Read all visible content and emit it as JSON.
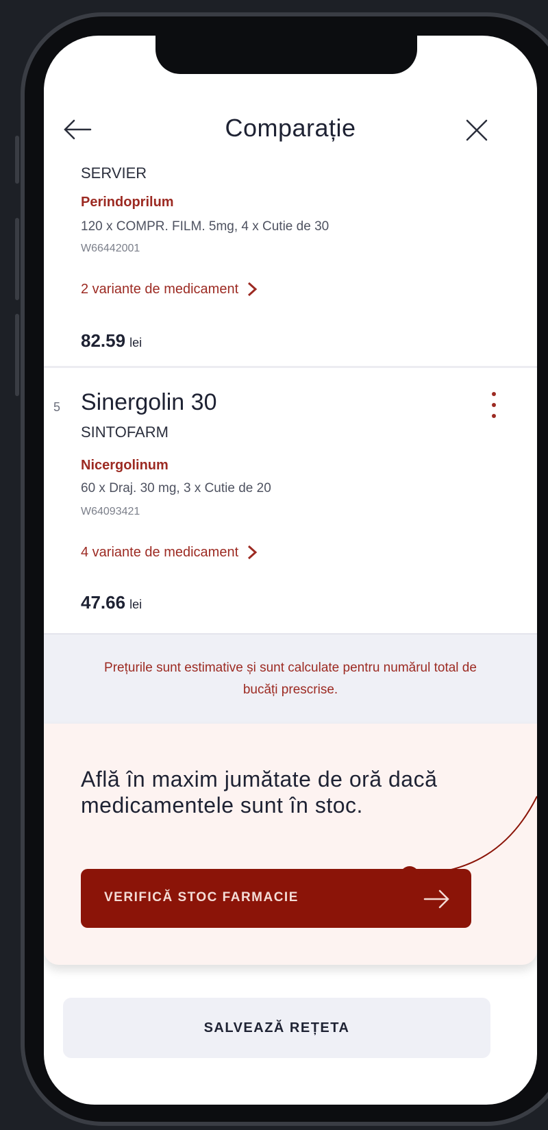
{
  "header": {
    "title": "Comparație"
  },
  "cards": [
    {
      "maker": "SERVIER",
      "substance": "Perindoprilum",
      "pack": "120 x COMPR. FILM. 5mg, 4 x Cutie de 30",
      "code": "W66442001",
      "variants_label": "2 variante de medicament",
      "price": "82.59",
      "currency": "lei"
    },
    {
      "index": "5",
      "name": "Sinergolin 30",
      "maker": "SINTOFARM",
      "substance": "Nicergolinum",
      "pack": "60 x Draj. 30 mg, 3 x Cutie de 20",
      "code": "W64093421",
      "variants_label": "4 variante de medicament",
      "price": "47.66",
      "currency": "lei"
    }
  ],
  "notice": "Prețurile sunt estimative și sunt calculate pentru numărul total de bucăți prescrise.",
  "promo": {
    "text": "Află în maxim jumătate de oră dacă medicamentele sunt în stoc.",
    "button_label": "VERIFICĂ STOC FARMACIE"
  },
  "save_button_label": "SALVEAZĂ REȚETA",
  "colors": {
    "accent": "#8b1408",
    "link": "#9c2a22",
    "notice_bg": "#eff0f6",
    "promo_bg": "#fdf3f1"
  },
  "icons": [
    "arrow-left-icon",
    "close-icon",
    "more-vertical-icon",
    "chevron-right-icon",
    "arrow-right-icon"
  ]
}
